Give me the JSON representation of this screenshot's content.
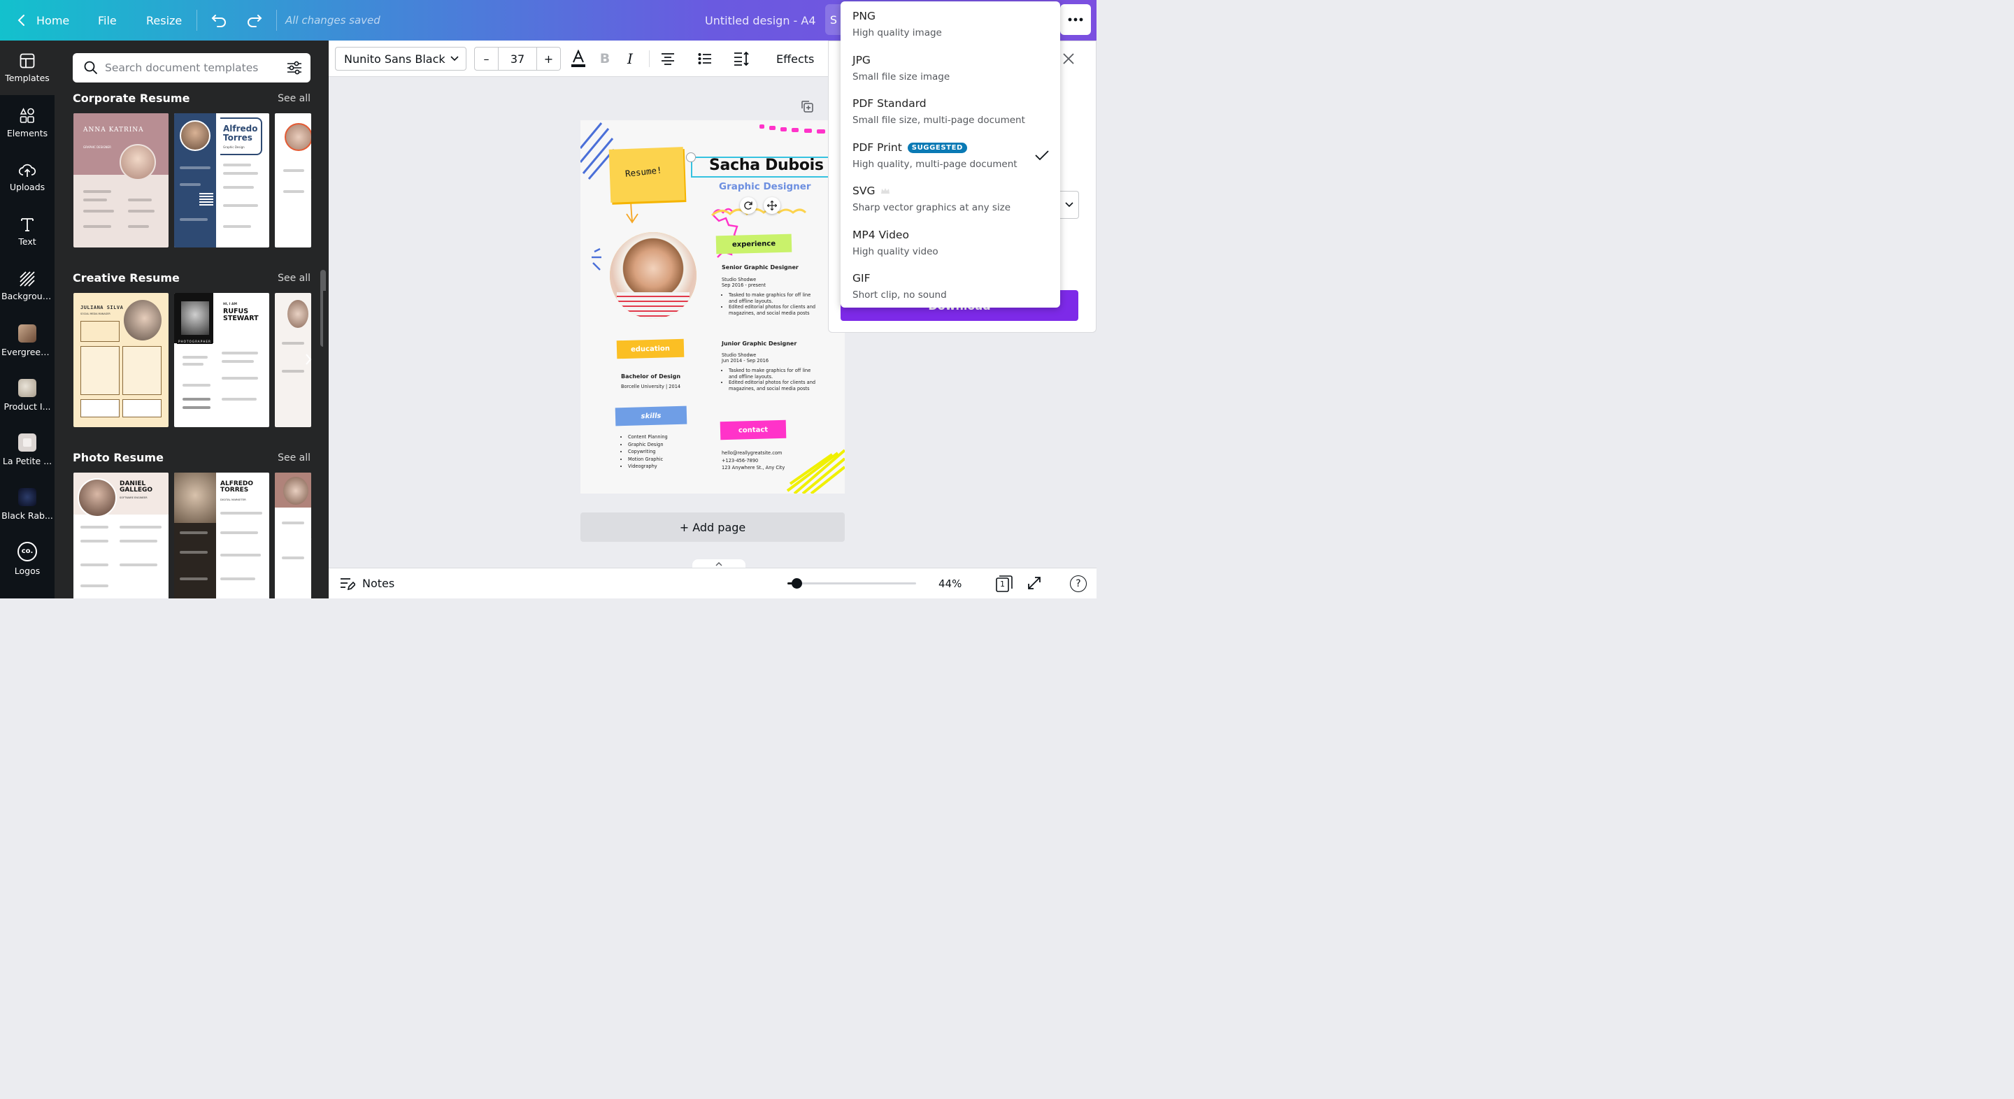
{
  "topbar": {
    "home": "Home",
    "file": "File",
    "resize": "Resize",
    "status": "All changes saved",
    "design_title": "Untitled design - A4",
    "share_partial": "S"
  },
  "rail": {
    "items": [
      {
        "label": "Templates"
      },
      {
        "label": "Elements"
      },
      {
        "label": "Uploads"
      },
      {
        "label": "Text"
      },
      {
        "label": "Background"
      },
      {
        "label": "Evergreen..."
      },
      {
        "label": "Product I..."
      },
      {
        "label": "La Petite ..."
      },
      {
        "label": "Black Rab..."
      },
      {
        "label": "Logos"
      }
    ],
    "logos_glyph": "co."
  },
  "panel": {
    "search_placeholder": "Search document templates",
    "see_all": "See all",
    "sections": [
      {
        "title": "Corporate Resume"
      },
      {
        "title": "Creative Resume"
      },
      {
        "title": "Photo Resume"
      }
    ],
    "cards": {
      "anna": {
        "name": "ANNA KATRINA",
        "role": "GRAPHIC DESIGNER"
      },
      "alfredo": {
        "name": "Alfredo Torres",
        "role": "Graphic Design"
      },
      "juliana": {
        "name": "JULIANA SILVA",
        "role": "SOCIAL MEDIA MANAGER"
      },
      "rufus": {
        "pre": "HI, I AM",
        "name": "RUFUS STEWART",
        "role": "PHOTOGRAPHER"
      },
      "daniel": {
        "name": "DANIEL GALLEGO",
        "role": "SOFTWARE ENGINEER"
      },
      "alfredo2": {
        "name": "ALFREDO TORRES",
        "role": "DIGITAL MARKETER"
      }
    }
  },
  "toolbar": {
    "font": "Nunito Sans Black",
    "minus": "–",
    "size": "37",
    "plus": "+",
    "bold": "B",
    "italic": "I",
    "effects": "Effects"
  },
  "resume": {
    "sticker": "Resume!",
    "name": "Sacha Dubois",
    "title": "Graphic Designer",
    "experience_label": "experience",
    "jobs": [
      {
        "role": "Senior Graphic Designer",
        "company": "Studio Shodwe",
        "dates": "Sep 2016 - present",
        "bullets": [
          "Tasked to make graphics for off line and offline layouts.",
          "Edited editorial photos for clients and magazines, and social media posts"
        ]
      },
      {
        "role": "Junior Graphic Designer",
        "company": "Studio Shodwe",
        "dates": "Jun 2014 - Sep 2016",
        "bullets": [
          "Tasked to make graphics for off line and offline layouts.",
          "Edited editorial photos for clients and magazines, and social media posts"
        ]
      }
    ],
    "education_label": "education",
    "degree": "Bachelor of Design",
    "school": "Borcelle University | 2014",
    "skills_label": "skills",
    "skills": [
      "Content Planning",
      "Graphic Design",
      "Copywriting",
      "Motion Graphic",
      "Videography"
    ],
    "contact_label": "contact",
    "contact": [
      "hello@reallygreatsite.com",
      "+123-456-7890",
      "123 Anywhere St., Any City"
    ]
  },
  "canvas": {
    "add_page": "+ Add page"
  },
  "bottombar": {
    "notes": "Notes",
    "zoom": "44%",
    "page_count": "1",
    "zoom_fraction": 0.07
  },
  "download": {
    "options": [
      {
        "title": "PNG",
        "subtitle": "High quality image"
      },
      {
        "title": "JPG",
        "subtitle": "Small file size image"
      },
      {
        "title": "PDF Standard",
        "subtitle": "Small file size, multi-page document"
      },
      {
        "title": "PDF Print",
        "subtitle": "High quality, multi-page document",
        "badge": "SUGGESTED",
        "selected": true
      },
      {
        "title": "SVG",
        "subtitle": "Sharp vector graphics at any size",
        "premium": true
      },
      {
        "title": "MP4 Video",
        "subtitle": "High quality video"
      },
      {
        "title": "GIF",
        "subtitle": "Short clip, no sound"
      }
    ],
    "button_partial": "Download"
  },
  "colors": {
    "accent_purple": "#7d2ae8",
    "suggested_badge": "#0a7ab5",
    "resume_yellow": "#fcd34d",
    "resume_cyan": "#35c2e0",
    "resume_pink": "#ff33c9",
    "resume_blue": "#4a6fd8"
  }
}
